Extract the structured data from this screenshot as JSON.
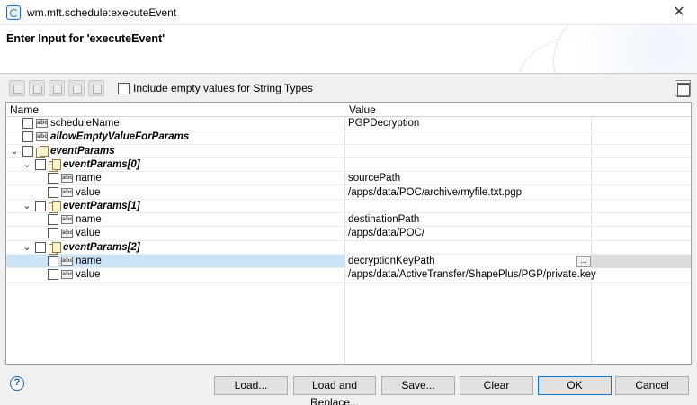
{
  "window": {
    "title": "wm.mft.schedule:executeEvent",
    "close_glyph": "✕",
    "icon": "app-icon"
  },
  "header": {
    "title": "Enter Input for 'executeEvent'"
  },
  "toolbar": {
    "buttons": [
      "expand-icon",
      "collapse-icon",
      "add-row-icon",
      "remove-row-icon",
      "edit-icon"
    ],
    "include_empty_label": "Include empty values for String Types",
    "include_empty_checked": false,
    "layout_toggle_icon": "layout-toggle-icon"
  },
  "table": {
    "columns": [
      "Name",
      "Value"
    ],
    "rows": [
      {
        "name": "scheduleName",
        "value": "PGPDecryption",
        "type": "string",
        "level": 0,
        "bold": false
      },
      {
        "name": "allowEmptyValueForParams",
        "value": "",
        "type": "string",
        "level": 0,
        "bold": true
      },
      {
        "name": "eventParams",
        "value": "",
        "type": "docarray",
        "level": 0,
        "bold": true,
        "expanded": true
      },
      {
        "name": "eventParams[0]",
        "value": "",
        "type": "doc",
        "level": 1,
        "bold": true,
        "expanded": true
      },
      {
        "name": "name",
        "value": "sourcePath",
        "type": "string",
        "level": 2,
        "bold": false
      },
      {
        "name": "value",
        "value": "/apps/data/POC/archive/myfile.txt.pgp",
        "type": "string",
        "level": 2,
        "bold": false
      },
      {
        "name": "eventParams[1]",
        "value": "",
        "type": "doc",
        "level": 1,
        "bold": true,
        "expanded": true
      },
      {
        "name": "name",
        "value": "destinationPath",
        "type": "string",
        "level": 2,
        "bold": false
      },
      {
        "name": "value",
        "value": "/apps/data/POC/",
        "type": "string",
        "level": 2,
        "bold": false
      },
      {
        "name": "eventParams[2]",
        "value": "",
        "type": "doc",
        "level": 1,
        "bold": true,
        "expanded": true
      },
      {
        "name": "name",
        "value": "decryptionKeyPath",
        "type": "string",
        "level": 2,
        "bold": false,
        "selected": true
      },
      {
        "name": "value",
        "value": "/apps/data/ActiveTransfer/ShapePlus/PGP/private.key",
        "type": "string",
        "level": 2,
        "bold": false
      }
    ],
    "string_icon_text": "abc",
    "ellipsis_label": "...",
    "expand_glyph": "⌄"
  },
  "footer": {
    "help_glyph": "?",
    "buttons": {
      "load": "Load...",
      "load_replace": "Load and Replace...",
      "save": "Save...",
      "clear": "Clear",
      "ok": "OK",
      "cancel": "Cancel"
    }
  },
  "colors": {
    "selection": "#cce4f7",
    "ok_border": "#0078d7",
    "accent": "#1a6fc4"
  }
}
